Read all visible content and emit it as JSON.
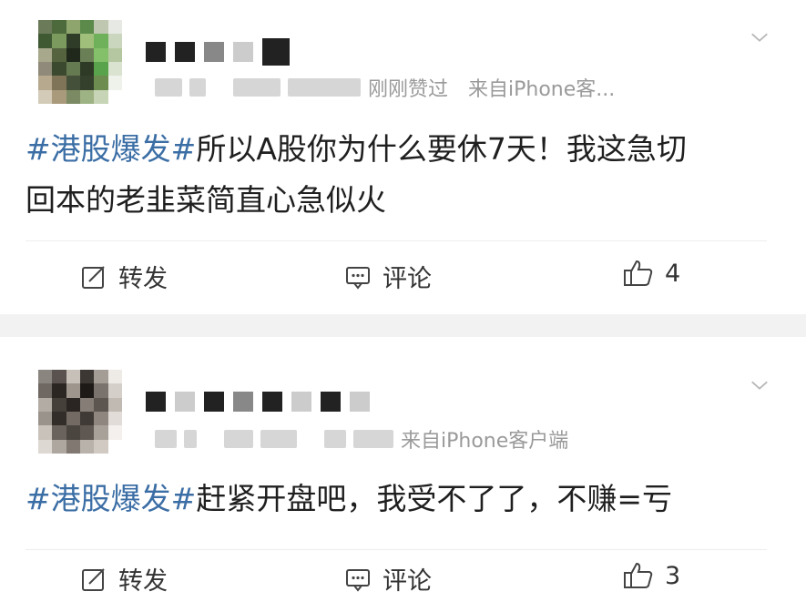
{
  "posts": [
    {
      "meta_text": "刚刚赞过",
      "source": "来自iPhone客...",
      "tag": "#港股爆发#",
      "text_line1": "所以A股你为什么要休7天！我这急切",
      "text_line2": "回本的老韭菜简直心急似火",
      "actions": {
        "repost": "转发",
        "comment": "评论",
        "like_count": "4"
      },
      "icons": {
        "more": "chevron-down-icon",
        "repost": "edit-share-icon",
        "comment": "comment-bubble-icon",
        "like": "thumbs-up-icon"
      }
    },
    {
      "source": "来自iPhone客户端",
      "tag": "#港股爆发#",
      "text_line1": "赶紧开盘吧，我受不了了，不赚=亏",
      "actions": {
        "repost": "转发",
        "comment": "评论",
        "like_count": "3"
      },
      "icons": {
        "more": "chevron-down-icon",
        "repost": "edit-share-icon",
        "comment": "comment-bubble-icon",
        "like": "thumbs-up-icon"
      }
    }
  ],
  "colors": {
    "hashtag": "#3b6ea5",
    "meta": "#9a9a9a",
    "separator": "#f2f2f2"
  }
}
